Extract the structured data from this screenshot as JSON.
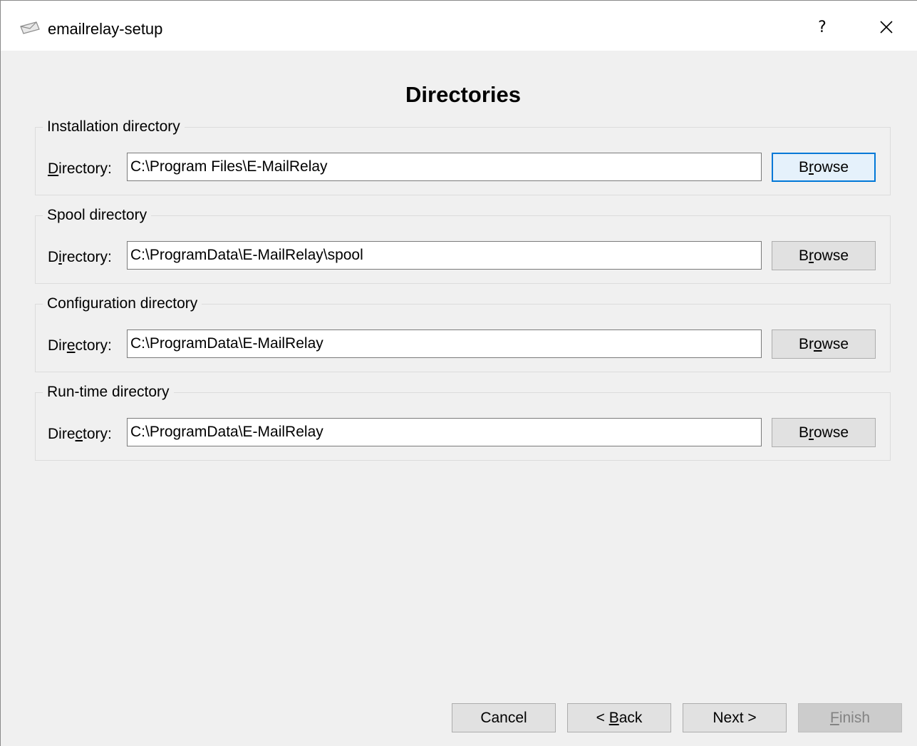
{
  "window": {
    "title": "emailrelay-setup",
    "help_label": "?",
    "close_label": "✕"
  },
  "page": {
    "title": "Directories"
  },
  "groups": [
    {
      "legend": "Installation directory",
      "label": "Directory:",
      "value": "C:\\Program Files\\E-MailRelay",
      "browse_label": "Browse"
    },
    {
      "legend": "Spool directory",
      "label": "Directory:",
      "value": "C:\\ProgramData\\E-MailRelay\\spool",
      "browse_label": "Browse"
    },
    {
      "legend": "Configuration directory",
      "label": "Directory:",
      "value": "C:\\ProgramData\\E-MailRelay",
      "browse_label": "Browse"
    },
    {
      "legend": "Run-time directory",
      "label": "Directory:",
      "value": "C:\\ProgramData\\E-MailRelay",
      "browse_label": "Browse"
    }
  ],
  "footer": {
    "cancel_label": "Cancel",
    "back_label": "< Back",
    "next_label": "Next >",
    "finish_label": "Finish"
  },
  "colors": {
    "focus_border": "#0078d7",
    "dialog_background": "#f0f0f0"
  }
}
